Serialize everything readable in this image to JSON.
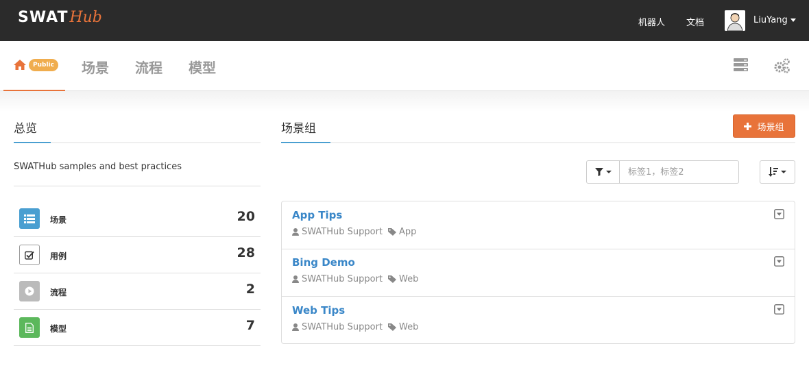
{
  "brand": {
    "name_main": "SWAT",
    "name_script": "Hub",
    "accent": "#e8733a"
  },
  "topbar": {
    "links": [
      "机器人",
      "文档"
    ],
    "user": {
      "name": "LiuYang"
    }
  },
  "subnav": {
    "home_badge": "Public",
    "items": [
      "场景",
      "流程",
      "模型"
    ]
  },
  "overview": {
    "title": "总览",
    "description": "SWATHub samples and best practices",
    "stats": [
      {
        "label": "场景",
        "count": "20",
        "icon": "list-icon",
        "color": "#4a9fd1"
      },
      {
        "label": "用例",
        "count": "28",
        "icon": "checkbox-icon",
        "color": "#ffffff"
      },
      {
        "label": "流程",
        "count": "2",
        "icon": "play-icon",
        "color": "#bbbbbb"
      },
      {
        "label": "模型",
        "count": "7",
        "icon": "document-icon",
        "color": "#5cb85c"
      }
    ]
  },
  "groups": {
    "title": "场景组",
    "add_button_label": "场景组",
    "filter_placeholder": "标签1，标签2",
    "items": [
      {
        "title": "App Tips",
        "owner": "SWATHub Support",
        "tag": "App"
      },
      {
        "title": "Bing Demo",
        "owner": "SWATHub Support",
        "tag": "Web"
      },
      {
        "title": "Web Tips",
        "owner": "SWATHub Support",
        "tag": "Web"
      }
    ]
  }
}
